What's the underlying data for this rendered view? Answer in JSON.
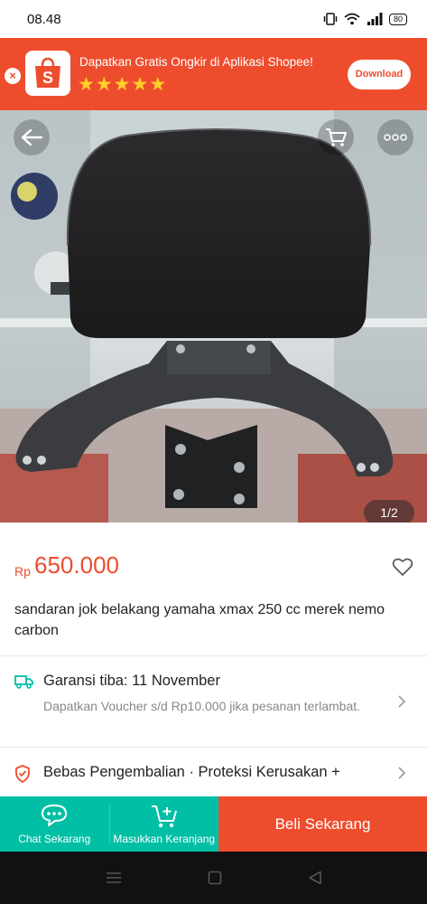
{
  "status_bar": {
    "time": "08.48",
    "battery": "80"
  },
  "banner": {
    "text": "Dapatkan Gratis Ongkir di Aplikasi Shopee!",
    "stars": 5,
    "download_label": "Download",
    "close_label": "×"
  },
  "gallery": {
    "counter": "1/2"
  },
  "product": {
    "price_currency": "Rp",
    "price_value": "650.000",
    "title": "sandaran jok belakang yamaha xmax 250 cc merek nemo carbon"
  },
  "shipping": {
    "title": "Garansi tiba: 11 November",
    "subtitle": "Dapatkan Voucher s/d Rp10.000 jika pesanan terlambat."
  },
  "protection": {
    "title": "Bebas Pengembalian · Proteksi Kerusakan +"
  },
  "actions": {
    "chat_label": "Chat Sekarang",
    "cart_label": "Masukkan Keranjang",
    "buy_label": "Beli Sekarang"
  },
  "colors": {
    "brand": "#ee4d2d",
    "teal": "#00bfa5",
    "star": "#ffcf2b"
  }
}
